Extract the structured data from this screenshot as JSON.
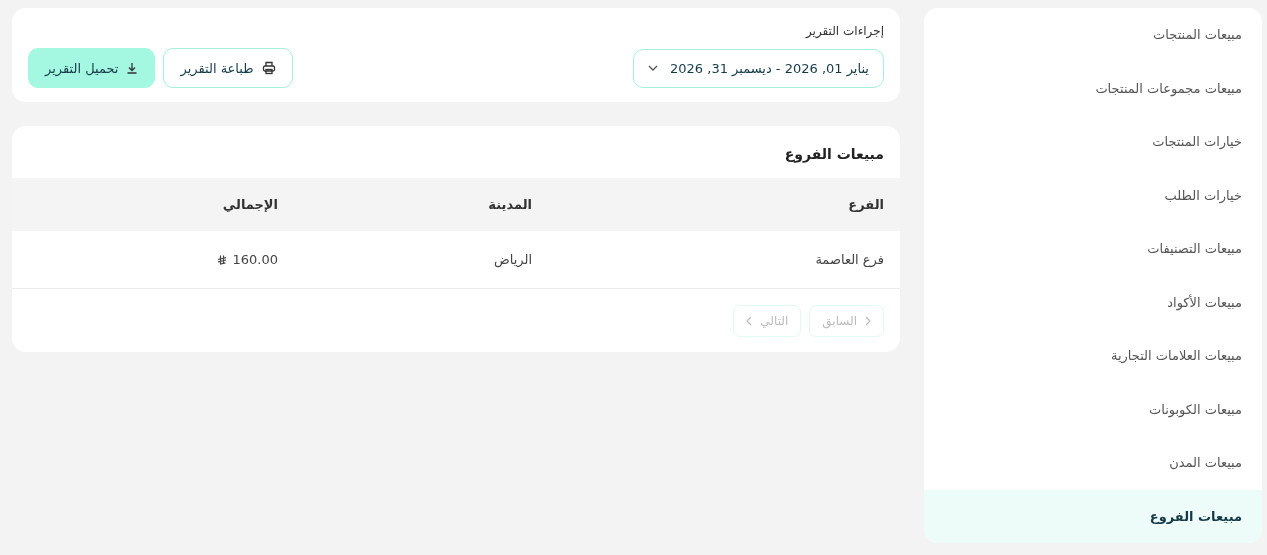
{
  "sidebar": {
    "items": [
      {
        "label": "مبيعات المنتجات",
        "selected": false
      },
      {
        "label": "مبيعات مجموعات المنتجات",
        "selected": false
      },
      {
        "label": "خيارات المنتجات",
        "selected": false
      },
      {
        "label": "خيارات الطلب",
        "selected": false
      },
      {
        "label": "مبيعات التصنيفات",
        "selected": false
      },
      {
        "label": "مبيعات الأكواد",
        "selected": false
      },
      {
        "label": "مبيعات العلامات التجارية",
        "selected": false
      },
      {
        "label": "مبيعات الكوبونات",
        "selected": false
      },
      {
        "label": "مبيعات المدن",
        "selected": false
      },
      {
        "label": "مبيعات الفروع",
        "selected": true
      }
    ]
  },
  "actions": {
    "title": "إجراءات التقرير",
    "date_range": "يناير 01, 2026  -  ديسمبر 31, 2026",
    "print_button": "طباعة التقرير",
    "download_button": "تحميل التقرير"
  },
  "report": {
    "title": "مبيعات الفروع",
    "columns": [
      "الفرع",
      "المدينة",
      "الإجمالي"
    ],
    "rows": [
      {
        "branch": "فرع العاصمة",
        "city": "الرياض",
        "total": "160.00"
      }
    ],
    "pagination": {
      "previous": {
        "label": "السابق",
        "disabled": true
      },
      "next": {
        "label": "التالي",
        "disabled": true
      }
    }
  }
}
